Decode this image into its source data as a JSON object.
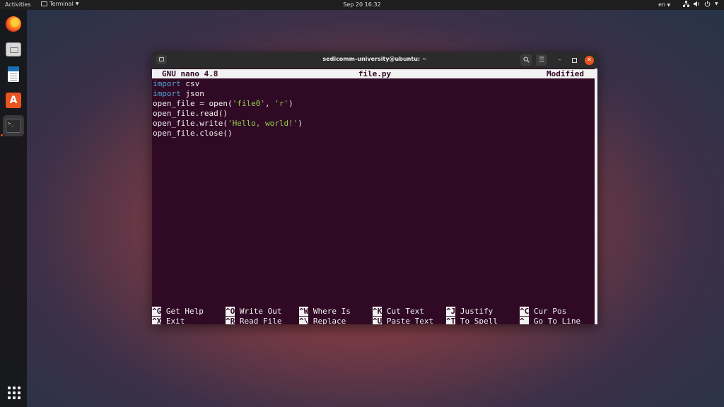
{
  "topbar": {
    "activities": "Activities",
    "app_menu": "Terminal",
    "clock": "Sep 20  16:32",
    "lang": "en"
  },
  "dock": {
    "items": [
      "firefox",
      "files",
      "libreoffice-writer",
      "software-center",
      "terminal"
    ]
  },
  "window": {
    "title": "sedicomm-university@ubuntu: ~"
  },
  "nano": {
    "version": "GNU nano 4.8",
    "filename": "file.py",
    "status": "Modified"
  },
  "code": [
    [
      {
        "t": "import",
        "c": "kw"
      },
      {
        "t": " csv",
        "c": ""
      }
    ],
    [
      {
        "t": "import",
        "c": "kw"
      },
      {
        "t": " json",
        "c": ""
      }
    ],
    [
      {
        "t": "open_file = open(",
        "c": ""
      },
      {
        "t": "'file0'",
        "c": "str"
      },
      {
        "t": ", ",
        "c": ""
      },
      {
        "t": "'r'",
        "c": "str"
      },
      {
        "t": ")",
        "c": ""
      }
    ],
    [
      {
        "t": "open_file.read()",
        "c": ""
      }
    ],
    [
      {
        "t": "open_file.write(",
        "c": ""
      },
      {
        "t": "'Hello, world!'",
        "c": "str"
      },
      {
        "t": ")",
        "c": ""
      }
    ],
    [
      {
        "t": "open_file.close()",
        "c": ""
      }
    ]
  ],
  "shortcuts": [
    [
      {
        "key": "^G",
        "label": "Get Help"
      },
      {
        "key": "^X",
        "label": "Exit"
      }
    ],
    [
      {
        "key": "^O",
        "label": "Write Out"
      },
      {
        "key": "^R",
        "label": "Read File"
      }
    ],
    [
      {
        "key": "^W",
        "label": "Where Is"
      },
      {
        "key": "^\\",
        "label": "Replace"
      }
    ],
    [
      {
        "key": "^K",
        "label": "Cut Text"
      },
      {
        "key": "^U",
        "label": "Paste Text"
      }
    ],
    [
      {
        "key": "^J",
        "label": "Justify"
      },
      {
        "key": "^T",
        "label": "To Spell"
      }
    ],
    [
      {
        "key": "^C",
        "label": "Cur Pos"
      },
      {
        "key": "^_",
        "label": "Go To Line"
      }
    ]
  ],
  "colors": {
    "terminal_bg": "#300a24",
    "keyword": "#4fa5d8",
    "string": "#8fd14b",
    "ubuntu_orange": "#e95420"
  }
}
